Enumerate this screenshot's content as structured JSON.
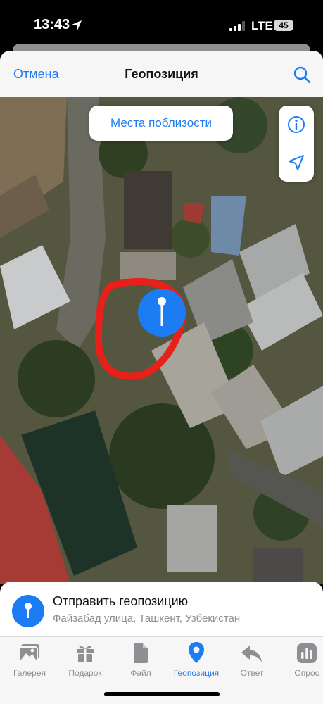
{
  "status_bar": {
    "time": "13:43",
    "network": "LTE",
    "battery": "45"
  },
  "header": {
    "cancel_label": "Отмена",
    "title": "Геопозиция"
  },
  "map": {
    "nearby_button_label": "Места поблизости"
  },
  "send_location": {
    "title": "Отправить геопозицию",
    "address": "Файзабад улица, Ташкент, Узбекистан"
  },
  "tabs": [
    {
      "label": "Галерея",
      "icon": "gallery-icon"
    },
    {
      "label": "Подарок",
      "icon": "gift-icon"
    },
    {
      "label": "Файл",
      "icon": "file-icon"
    },
    {
      "label": "Геопозиция",
      "icon": "location-pin-icon"
    },
    {
      "label": "Ответ",
      "icon": "reply-icon"
    },
    {
      "label": "Опрос",
      "icon": "poll-icon"
    }
  ],
  "colors": {
    "accent": "#1c7cf4",
    "annotation": "#e8201a",
    "inactive": "#8e8e93"
  }
}
